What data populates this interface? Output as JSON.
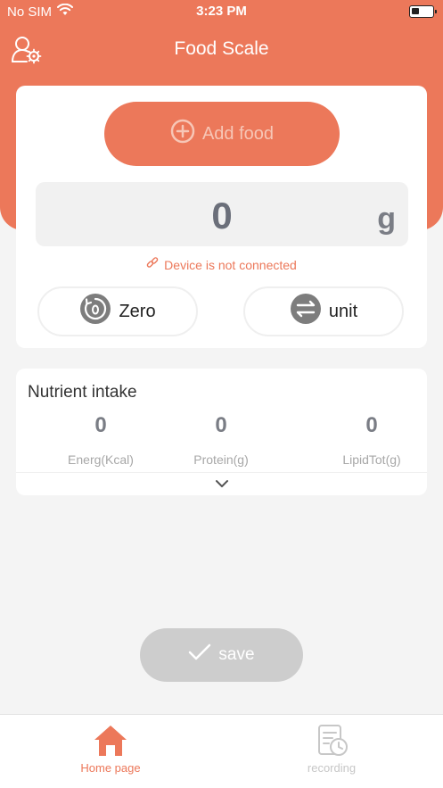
{
  "status_bar": {
    "carrier": "No SIM",
    "time": "3:23 PM"
  },
  "header": {
    "title": "Food Scale"
  },
  "scale": {
    "add_food_label": "Add food",
    "weight_value": "0",
    "weight_unit": "g",
    "device_status": "Device is not connected",
    "zero_label": "Zero",
    "unit_label": "unit"
  },
  "nutrients": {
    "title": "Nutrient intake",
    "items": [
      {
        "value": "0",
        "label": "Energ(Kcal)"
      },
      {
        "value": "0",
        "label": "Protein(g)"
      },
      {
        "value": "0",
        "label": "LipidTot(g)"
      }
    ]
  },
  "save_label": "save",
  "tabs": [
    {
      "label": "Home page",
      "active": true
    },
    {
      "label": "recording",
      "active": false
    }
  ],
  "colors": {
    "accent": "#ec785a",
    "disabled": "#cdcdcd",
    "inactive_tab": "#c7c7c7"
  }
}
